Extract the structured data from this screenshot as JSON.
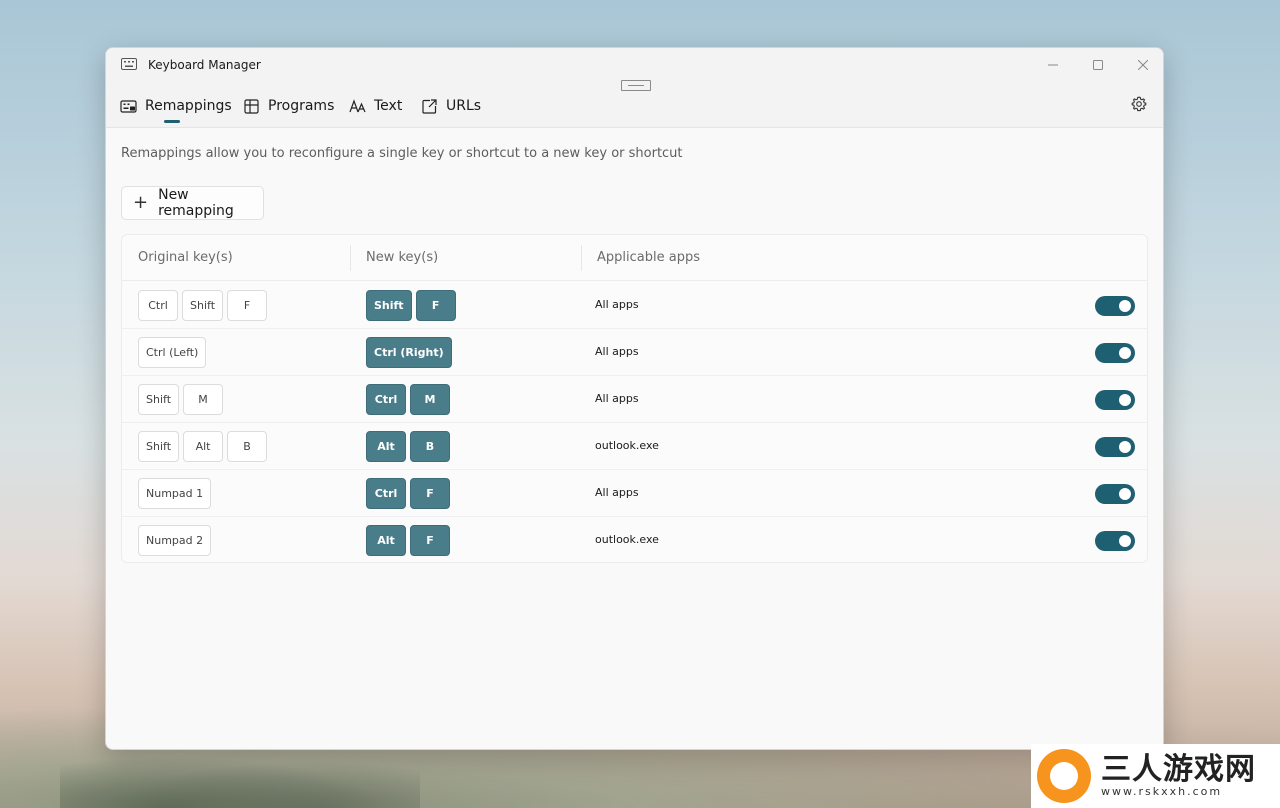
{
  "window": {
    "title": "Keyboard Manager"
  },
  "tabs": [
    {
      "label": "Remappings",
      "icon": "keyboard-remap-icon",
      "active": true
    },
    {
      "label": "Programs",
      "icon": "programs-icon",
      "active": false
    },
    {
      "label": "Text",
      "icon": "text-icon",
      "active": false
    },
    {
      "label": "URLs",
      "icon": "open-url-icon",
      "active": false
    }
  ],
  "description": "Remappings allow you to reconfigure a single key or shortcut to a new key or shortcut",
  "new_button": {
    "label": "New remapping",
    "icon": "plus-icon"
  },
  "table": {
    "headers": [
      "Original key(s)",
      "New key(s)",
      "Applicable apps"
    ],
    "rows": [
      {
        "original": [
          "Ctrl",
          "Shift",
          "F"
        ],
        "new": [
          "Shift",
          "F"
        ],
        "app": "All apps",
        "enabled": true
      },
      {
        "original": [
          "Ctrl (Left)"
        ],
        "new": [
          "Ctrl (Right)"
        ],
        "app": "All apps",
        "enabled": true
      },
      {
        "original": [
          "Shift",
          "M"
        ],
        "new": [
          "Ctrl",
          "M"
        ],
        "app": "All apps",
        "enabled": true
      },
      {
        "original": [
          "Shift",
          "Alt",
          "B"
        ],
        "new": [
          "Alt",
          "B"
        ],
        "app": "outlook.exe",
        "enabled": true
      },
      {
        "original": [
          "Numpad 1"
        ],
        "new": [
          "Ctrl",
          "F"
        ],
        "app": "All apps",
        "enabled": true
      },
      {
        "original": [
          "Numpad 2"
        ],
        "new": [
          "Alt",
          "F"
        ],
        "app": "outlook.exe",
        "enabled": true
      }
    ]
  },
  "colors": {
    "accent": "#1f5f72",
    "key_dark": "#4a7d8a"
  },
  "watermark": {
    "title": "三人游戏网",
    "url": "www.rskxxh.com"
  }
}
